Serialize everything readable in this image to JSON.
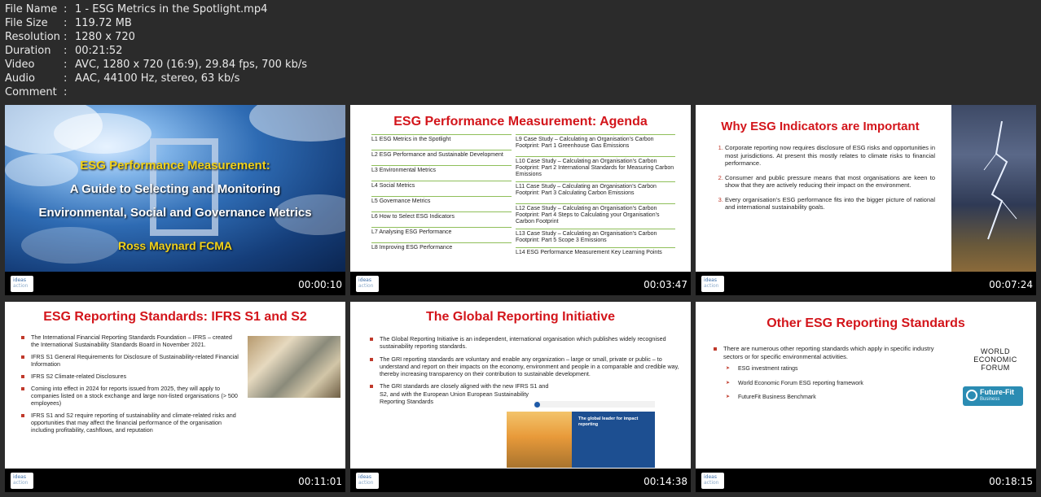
{
  "meta": [
    {
      "key": "File Name",
      "value": "1 - ESG Metrics in the Spotlight.mp4"
    },
    {
      "key": "File Size",
      "value": "119.72 MB"
    },
    {
      "key": "Resolution",
      "value": "1280 x 720"
    },
    {
      "key": "Duration",
      "value": "00:21:52"
    },
    {
      "key": "Video",
      "value": "AVC, 1280 x 720 (16:9), 29.84 fps, 700 kb/s"
    },
    {
      "key": "Audio",
      "value": "AAC, 44100 Hz, stereo, 63 kb/s"
    },
    {
      "key": "Comment",
      "value": ""
    }
  ],
  "meta_separator": ":",
  "logo": {
    "line1": "ideas",
    "line2": "action"
  },
  "tiles": [
    {
      "timestamp": "00:00:10",
      "title_line1": "ESG Performance Measurement:",
      "title_line2": "A Guide to Selecting and Monitoring",
      "title_line3": "Environmental, Social and Governance Metrics",
      "author": "Ross Maynard FCMA"
    },
    {
      "timestamp": "00:03:47",
      "title": "ESG Performance Measurement: Agenda",
      "left_items": [
        "L1 ESG Metrics in the Spotlight",
        "L2 ESG Performance and Sustainable Development",
        "L3 Environmental Metrics",
        "L4 Social Metrics",
        "L5 Governance Metrics",
        "L6 How to Select ESG Indicators",
        "L7 Analysing ESG Performance",
        "L8 Improving ESG Performance"
      ],
      "right_items": [
        "L9 Case Study – Calculating an Organisation’s Carbon Footprint: Part 1 Greenhouse Gas Emissions",
        "L10 Case Study – Calculating an Organisation’s Carbon Footprint: Part 2 International Standards for Measuring Carbon Emissions",
        "L11 Case Study – Calculating an Organisation’s Carbon Footprint: Part 3 Calculating Carbon Emissions",
        "L12 Case Study – Calculating an Organisation’s Carbon Footprint: Part 4 Steps to Calculating your Organisation’s Carbon Footprint",
        "L13 Case Study – Calculating an Organisation’s Carbon Footprint: Part 5 Scope 3 Emissions",
        "L14 ESG Performance Measurement Key Learning Points"
      ]
    },
    {
      "timestamp": "00:07:24",
      "title": "Why ESG Indicators are Important",
      "items": [
        "Corporate reporting now requires disclosure of ESG risks and opportunities in most jurisdictions. At present this mostly relates to climate risks to financial performance.",
        "Consumer and public pressure means that most organisations are keen to show that they are actively reducing their impact on the environment.",
        "Every organisation’s ESG performance fits into the bigger picture of national and international sustainability goals."
      ]
    },
    {
      "timestamp": "00:11:01",
      "title": "ESG Reporting Standards: IFRS S1 and S2",
      "items": [
        "The International Financial Reporting Standards Foundation – IFRS – created the International Sustainability Standards Board in November 2021.",
        "IFRS S1 General Requirements for Disclosure of Sustainability-related Financial Information",
        "IFRS S2 Climate-related Disclosures",
        "Coming into effect in 2024 for reports issued from 2025, they will apply to companies listed on a stock exchange and large non-listed organisations (> 500 employees)",
        "IFRS S1 and S2 require reporting of sustainability and climate-related risks and opportunities that may affect the financial performance of the organisation including profitability, cashflows, and reputation"
      ]
    },
    {
      "timestamp": "00:14:38",
      "title": "The Global Reporting Initiative",
      "items": [
        "The Global Reporting Initiative is an independent, international organisation which publishes widely recognised sustainability reporting standards.",
        "The GRI reporting standards are voluntary and enable any organization – large or small, private or public – to understand and report on their impacts on the economy, environment and people in a comparable and credible way, thereby increasing transparency on their contribution to sustainable development.",
        "The GRI standards are closely aligned with the new IFRS S1 and S2, and with the European Union European Sustainability Reporting Standards"
      ],
      "panel_heading": "The global leader for impact reporting"
    },
    {
      "timestamp": "00:18:15",
      "title": "Other ESG Reporting Standards",
      "intro": "There are numerous other reporting standards which apply in specific industry sectors or for specific environmental activities.",
      "items": [
        "ESG investment ratings",
        "World Economic Forum ESG reporting framework",
        "FutureFit Business Benchmark"
      ],
      "wef_line1": "WORLD",
      "wef_line2": "ECONOMIC",
      "wef_line3": "FORUM",
      "ff_name": "Future-Fit",
      "ff_sub": "Business"
    }
  ],
  "colors": {
    "title_red": "#d3151b",
    "bullet_red": "#c0392b",
    "agenda_rule": "#8fbf5a",
    "slide_bg": "#ffffff",
    "page_bg": "#2b2b2b"
  }
}
